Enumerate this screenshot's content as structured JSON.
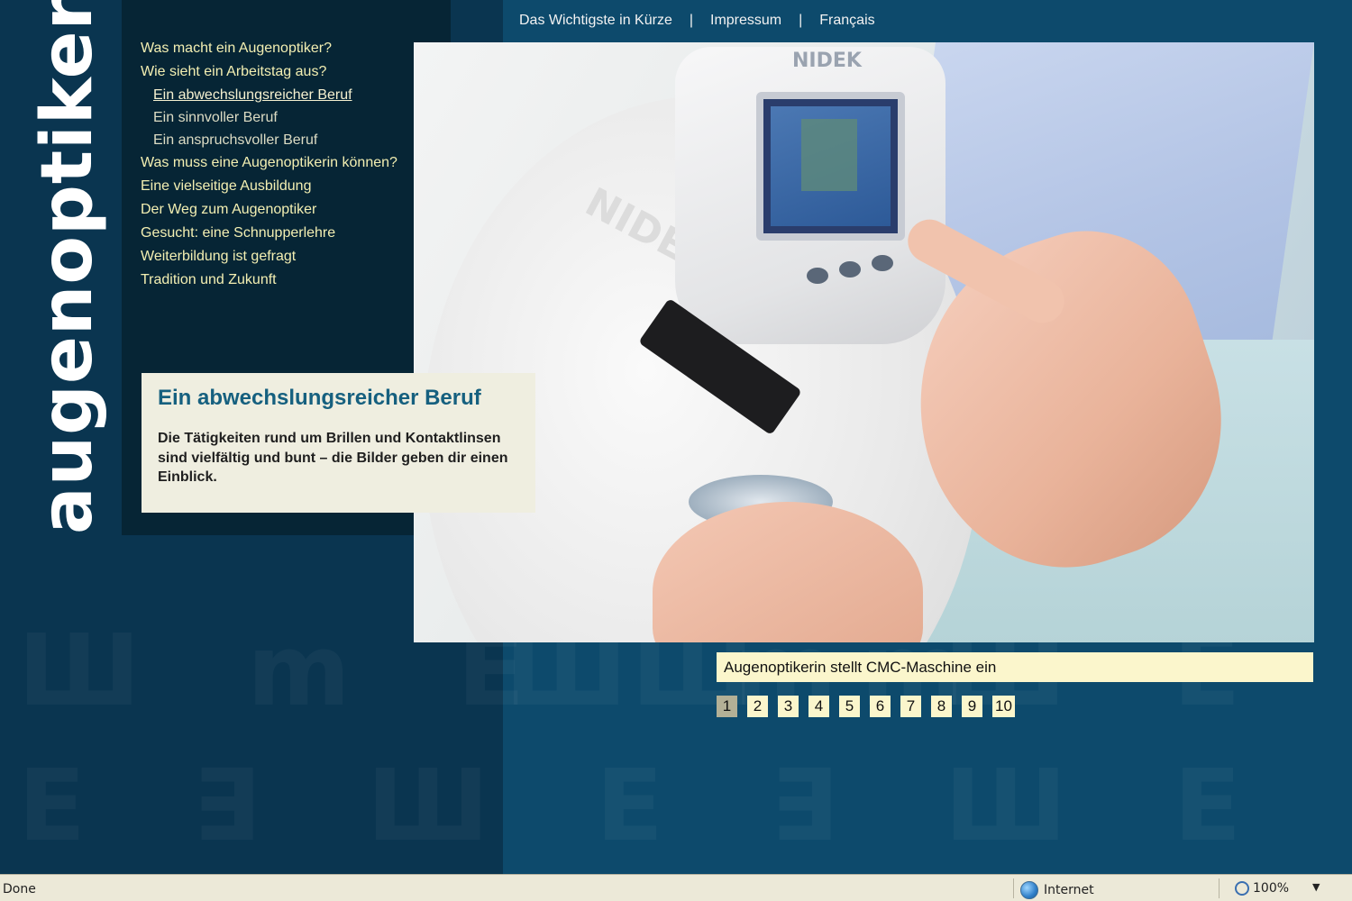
{
  "logo": {
    "text": "augenoptiker"
  },
  "topnav": [
    {
      "label": "Das Wichtigste in Kürze"
    },
    {
      "label": "Impressum"
    },
    {
      "label": "Français"
    }
  ],
  "topnav_separator": "|",
  "menu": [
    {
      "label": "Was macht ein Augenoptiker?",
      "level": 1,
      "active": false
    },
    {
      "label": "Wie sieht ein Arbeitstag aus?",
      "level": 1,
      "active": false
    },
    {
      "label": "Ein abwechslungsreicher Beruf",
      "level": 2,
      "active": true
    },
    {
      "label": "Ein sinnvoller Beruf",
      "level": 2,
      "active": false
    },
    {
      "label": "Ein anspruchsvoller Beruf",
      "level": 2,
      "active": false
    },
    {
      "label": "Was muss eine Augenoptikerin können?",
      "level": 1,
      "active": false
    },
    {
      "label": "Eine vielseitige Ausbildung",
      "level": 1,
      "active": false
    },
    {
      "label": "Der Weg zum Augenoptiker",
      "level": 1,
      "active": false
    },
    {
      "label": "Gesucht: eine Schnupperlehre",
      "level": 1,
      "active": false
    },
    {
      "label": "Weiterbildung ist gefragt",
      "level": 1,
      "active": false
    },
    {
      "label": "Tradition und Zukunft",
      "level": 1,
      "active": false
    }
  ],
  "photo": {
    "brand_label": "NIDEK"
  },
  "infobox": {
    "title": "Ein abwechslungsreicher Beruf",
    "text": "Die Tätigkeiten rund um Brillen und Kontaktlinsen sind vielfältig und bunt – die Bilder geben dir einen Einblick."
  },
  "caption": "Augenoptikerin stellt CMC-Maschine ein",
  "pager": {
    "pages": [
      "1",
      "2",
      "3",
      "4",
      "5",
      "6",
      "7",
      "8",
      "9",
      "10"
    ],
    "current": "1"
  },
  "statusbar": {
    "status": "Done",
    "zone": "Internet",
    "zoom": "100%"
  },
  "colors": {
    "left_background": "#0a3550",
    "right_background": "#0d4a6c",
    "nav_background": "#062535",
    "menu_text": "#f3efb2",
    "infobox_title": "#16607f",
    "caption_background": "#fbf6cc"
  }
}
